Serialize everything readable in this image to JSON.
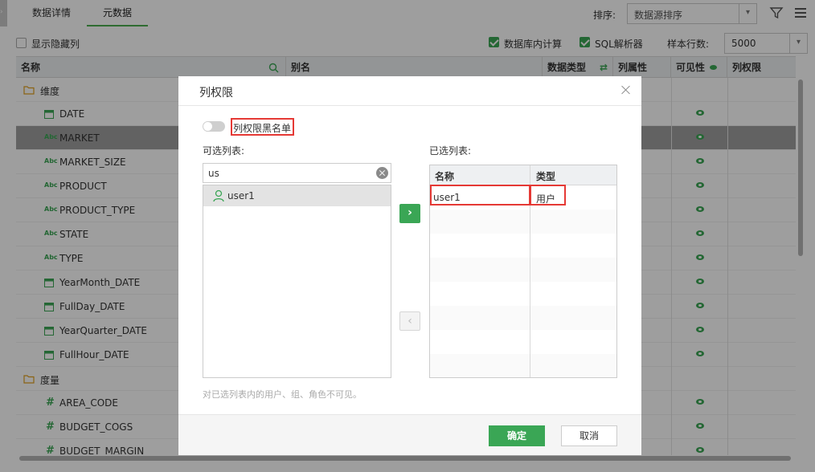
{
  "app": {
    "tabs": [
      {
        "label": "数据详情"
      },
      {
        "label": "元数据"
      }
    ],
    "sort_label": "排序:",
    "sort_value": "数据源排序",
    "show_hidden_label": "显示隐藏列",
    "db_compute_label": "数据库内计算",
    "sql_parser_label": "SQL解析器",
    "sample_rows_label": "样本行数:",
    "sample_rows_value": "5000",
    "columns": {
      "name": "名称",
      "alias": "别名",
      "data_type": "数据类型",
      "col_attr": "列属性",
      "visibility": "可见性",
      "col_permission": "列权限"
    },
    "groups": {
      "dimension": "维度",
      "measure": "度量"
    },
    "rows": [
      {
        "name": "DATE",
        "icon": "calendar-icon"
      },
      {
        "name": "MARKET",
        "icon": "abc-icon"
      },
      {
        "name": "MARKET_SIZE",
        "icon": "abc-icon"
      },
      {
        "name": "PRODUCT",
        "icon": "abc-icon"
      },
      {
        "name": "PRODUCT_TYPE",
        "icon": "abc-icon"
      },
      {
        "name": "STATE",
        "icon": "abc-icon"
      },
      {
        "name": "TYPE",
        "icon": "abc-icon"
      },
      {
        "name": "YearMonth_DATE",
        "icon": "calendar-icon"
      },
      {
        "name": "FullDay_DATE",
        "icon": "calendar-icon"
      },
      {
        "name": "YearQuarter_DATE",
        "icon": "calendar-icon"
      },
      {
        "name": "FullHour_DATE",
        "icon": "calendar-icon"
      }
    ],
    "measure_rows": [
      {
        "name": "AREA_CODE",
        "icon": "hash-icon"
      },
      {
        "name": "BUDGET_COGS",
        "icon": "hash-icon"
      },
      {
        "name": "BUDGET_MARGIN",
        "icon": "hash-icon"
      }
    ],
    "abc_glyph": "Abc",
    "hash_glyph": "#"
  },
  "dialog": {
    "title": "列权限",
    "blacklist_label": "列权限黑名单",
    "available_label": "可选列表:",
    "selected_label": "已选列表:",
    "search_value": "us",
    "available_items": [
      {
        "name": "user1"
      }
    ],
    "selected_columns": {
      "name": "名称",
      "type": "类型"
    },
    "selected_items": [
      {
        "name": "user1",
        "type": "用户"
      }
    ],
    "hint": "对已选列表内的用户、组、角色不可见。",
    "add_glyph": "›",
    "remove_glyph": "‹",
    "ok_label": "确定",
    "cancel_label": "取消"
  },
  "colors": {
    "accent": "#3aa655",
    "highlight": "#e53935",
    "selected_row": "#9e9e9e"
  }
}
